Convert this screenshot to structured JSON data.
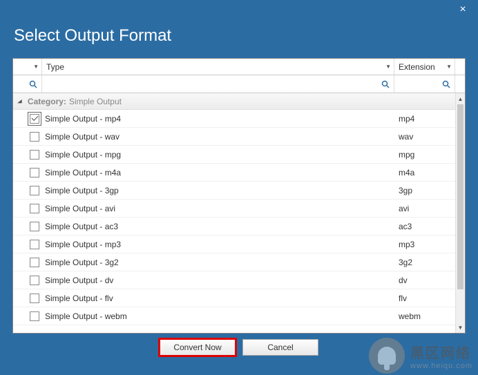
{
  "title": "Select Output Format",
  "columns": {
    "checkbox": "",
    "type": "Type",
    "extension": "Extension"
  },
  "category": {
    "prefix": "Category:",
    "name": "Simple Output"
  },
  "rows": [
    {
      "checked": true,
      "type": "Simple Output - mp4",
      "ext": "mp4"
    },
    {
      "checked": false,
      "type": "Simple Output - wav",
      "ext": "wav"
    },
    {
      "checked": false,
      "type": "Simple Output - mpg",
      "ext": "mpg"
    },
    {
      "checked": false,
      "type": "Simple Output - m4a",
      "ext": "m4a"
    },
    {
      "checked": false,
      "type": "Simple Output - 3gp",
      "ext": "3gp"
    },
    {
      "checked": false,
      "type": "Simple Output - avi",
      "ext": "avi"
    },
    {
      "checked": false,
      "type": "Simple Output - ac3",
      "ext": "ac3"
    },
    {
      "checked": false,
      "type": "Simple Output - mp3",
      "ext": "mp3"
    },
    {
      "checked": false,
      "type": "Simple Output - 3g2",
      "ext": "3g2"
    },
    {
      "checked": false,
      "type": "Simple Output - dv",
      "ext": "dv"
    },
    {
      "checked": false,
      "type": "Simple Output - flv",
      "ext": "flv"
    },
    {
      "checked": false,
      "type": "Simple Output - webm",
      "ext": "webm"
    }
  ],
  "buttons": {
    "convert": "Convert Now",
    "cancel": "Cancel"
  },
  "watermark": {
    "cn": "黑区网络",
    "en": "www.heiqu.com"
  }
}
